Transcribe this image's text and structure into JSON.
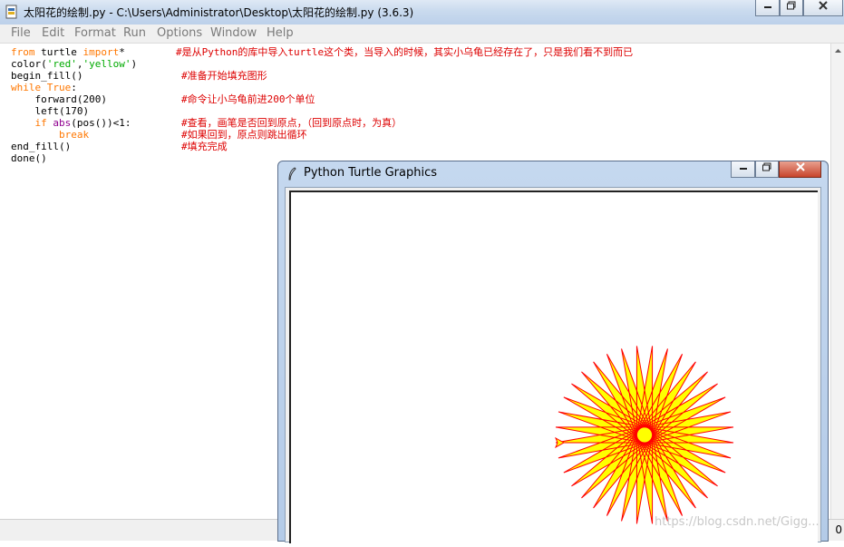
{
  "editor_window": {
    "title": "太阳花的绘制.py - C:\\Users\\Administrator\\Desktop\\太阳花的绘制.py (3.6.3)"
  },
  "menu": [
    {
      "label": "File"
    },
    {
      "label": "Edit"
    },
    {
      "label": "Format"
    },
    {
      "label": "Run"
    },
    {
      "label": "Options"
    },
    {
      "label": "Window"
    },
    {
      "label": "Help"
    }
  ],
  "code": {
    "l1_from": "from",
    "l1_mod": " turtle ",
    "l1_import": "import",
    "l1_star": "*",
    "l1_comment": "#是从Python的库中导入turtle这个类，当导入的时候，其实小乌龟已经存在了，只是我们看不到而已",
    "l2_fn": "color(",
    "l2_s1": "'red'",
    "l2_comma": ",",
    "l2_s2": "'yellow'",
    "l2_close": ")",
    "l3_fn": "begin_fill()",
    "l3_comment": "#准备开始填充图形",
    "l4_while": "while",
    "l4_true": " True",
    "l4_colon": ":",
    "l5_code": "    forward(200)",
    "l5_comment": "#命令让小乌龟前进200个单位",
    "l6_code": "    left(170)",
    "l7_if": "    if ",
    "l7_abs": "abs",
    "l7_rest": "(pos())<1:",
    "l7_comment": "#查看，画笔是否回到原点，（回到原点时，为真）",
    "l8_break": "        break",
    "l8_comment": "#如果回到，原点则跳出循环",
    "l9_code": "end_fill()",
    "l9_comment": "#填充完成",
    "l10_code": "done()"
  },
  "turtle_window": {
    "title": "Python Turtle Graphics"
  },
  "drawing": {
    "pen_color": "#ff0000",
    "fill_color": "#ffff00",
    "forward": 200,
    "left_angle": 170,
    "turtle_icon": "arrow-cursor-icon"
  },
  "statusbar": {
    "col_fragment": "0"
  },
  "watermark": "https://blog.csdn.net/Gigg..."
}
